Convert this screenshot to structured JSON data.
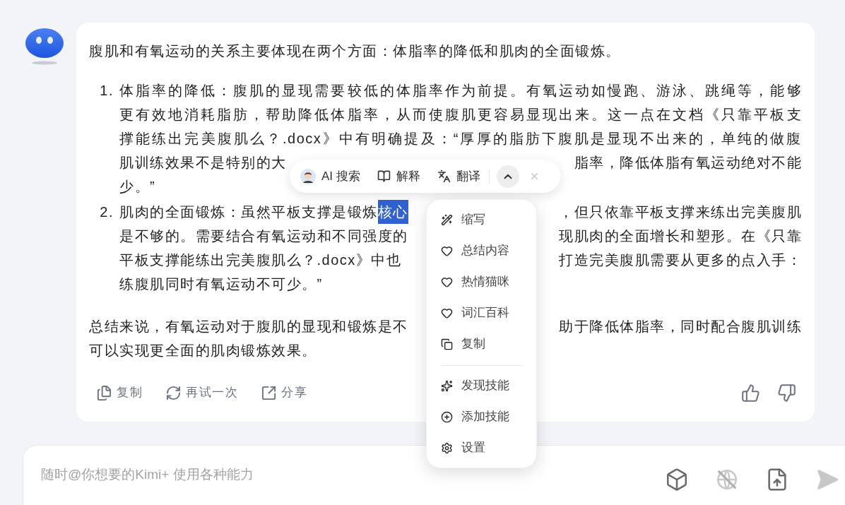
{
  "message": {
    "intro": "腹肌和有氧运动的关系主要体现在两个方面：体脂率的降低和肌肉的全面锻炼。",
    "list": [
      {
        "number": "1.",
        "lines": [
          {
            "left": "体脂率的降低：腹肌的显现需要较低的体脂率作为前提。有氧运动如慢跑、游泳、跳绳等，能够"
          },
          {
            "left": "更有效地消耗脂肪，帮助降低体脂率，从而使腹肌更容易显现出来。这一点在文档《只靠平板支"
          },
          {
            "left": "撑能练出完美腹肌么？.docx》中有明确提及：“厚厚的脂肪下腹肌是显现不出来的，单纯的做腹"
          },
          {
            "left": "肌训练效果不是特别的大",
            "right": "脂率，降低体脂有氧运动绝对不能"
          },
          {
            "left": "少。”"
          }
        ]
      },
      {
        "number": "2.",
        "lines": [
          {
            "left": "肌肉的全面锻炼：虽然平板支撑是锻炼",
            "selection": "核心",
            "right": "，但只依靠平板支撑来练出完美腹肌"
          },
          {
            "left": "是不够的。需要结合有氧运动和不同强度的",
            "right": "现肌肉的全面增长和塑形。在《只靠"
          },
          {
            "left": "平板支撑能练出完美腹肌么？.docx》中也",
            "right": "打造完美腹肌需要从更多的点入手："
          },
          {
            "left": "练腹肌同时有氧运动不可少。”"
          }
        ]
      }
    ],
    "summary": [
      {
        "left": "总结来说，有氧运动对于腹肌的显现和锻炼是不",
        "right": "助于降低体脂率，同时配合腹肌训练"
      },
      {
        "left": "可以实现更全面的肌肉锻炼效果。"
      }
    ],
    "actions": [
      "复制",
      "再试一次",
      "分享"
    ]
  },
  "selection_toolbar": {
    "items": [
      "AI 搜索",
      "解释",
      "翻译"
    ],
    "expanded": true
  },
  "selection_menu": {
    "groups": [
      [
        "缩写",
        "总结内容",
        "热情猫咪",
        "词汇百科",
        "复制"
      ],
      [
        "发现技能",
        "添加技能",
        "设置"
      ]
    ]
  },
  "composer": {
    "placeholder": "随时@你想要的Kimi+ 使用各种能力",
    "web_search": {
      "on": false
    },
    "send": {
      "disabled": true
    }
  }
}
